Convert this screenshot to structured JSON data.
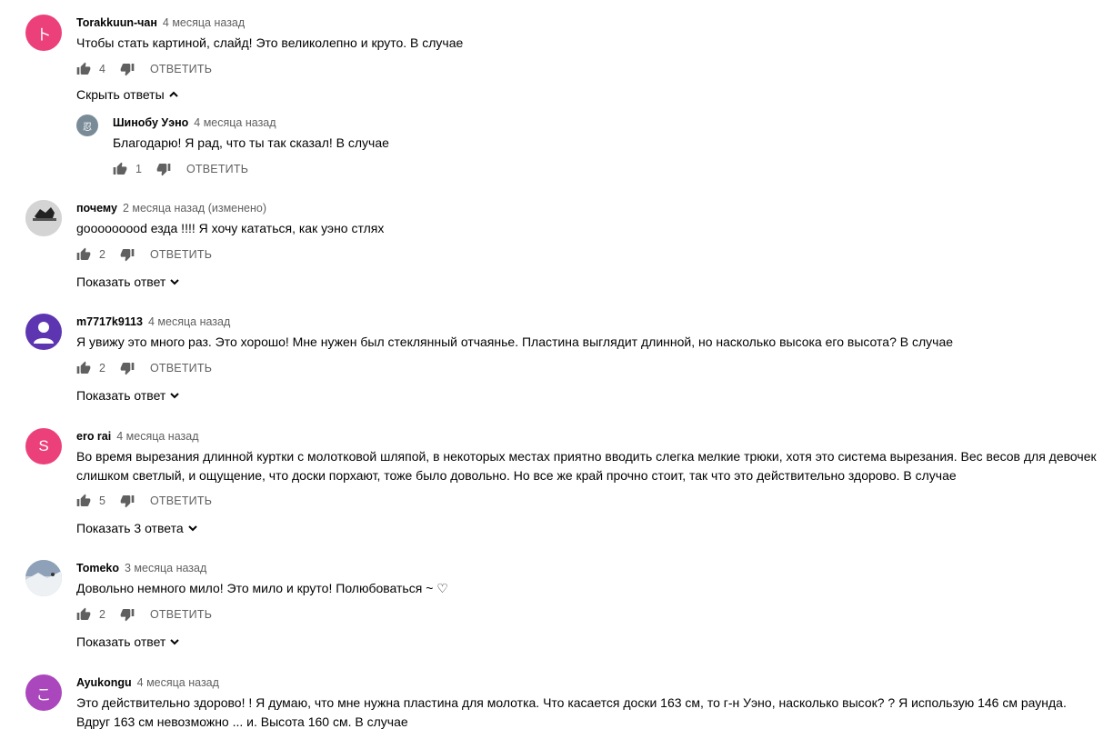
{
  "comments": [
    {
      "avatar_letter": "ト",
      "avatar_color": "#ec407a",
      "author": "Torakkuun-чан",
      "time": "4 месяца назад",
      "text": "Чтобы стать картиной, слайд! Это великолепно и круто. В случае",
      "likes": "4",
      "reply_label": "ОТВЕТИТЬ",
      "toggle": "Скрыть ответы",
      "replies": [
        {
          "avatar_letter": "忍",
          "avatar_color": "#7a8b98",
          "author": "Шинобу Уэно",
          "time": "4 месяца назад",
          "text": "Благодарю! Я рад, что ты так сказал! В случае",
          "likes": "1",
          "reply_label": "ОТВЕТИТЬ"
        }
      ]
    },
    {
      "avatar_letter": "",
      "avatar_color": "#d9d9d9",
      "author": "почему",
      "time": "2 месяца назад (изменено)",
      "text": "gooooooood езда !!!! Я хочу кататься, как уэно стлях",
      "likes": "2",
      "reply_label": "ОТВЕТИТЬ",
      "toggle": "Показать ответ"
    },
    {
      "avatar_letter": "",
      "avatar_color": "#5e35b1",
      "author": "m7717k9113",
      "time": "4 месяца назад",
      "text": "Я увижу это много раз. Это хорошо! Мне нужен был стеклянный отчаянье. Пластина выглядит длинной, но насколько высока его высота? В случае",
      "likes": "2",
      "reply_label": "ОТВЕТИТЬ",
      "toggle": "Показать ответ"
    },
    {
      "avatar_letter": "S",
      "avatar_color": "#ec407a",
      "author": "ero rai",
      "time": "4 месяца назад",
      "text": "Во время вырезания длинной куртки с молотковой шляпой, в некоторых местах приятно вводить слегка мелкие трюки, хотя это система вырезания. Вес весов для девочек слишком светлый, и ощущение, что доски порхают, тоже было довольно. Но все же край прочно стоит, так что это действительно здорово. В случае",
      "likes": "5",
      "reply_label": "ОТВЕТИТЬ",
      "toggle": "Показать 3 ответа"
    },
    {
      "avatar_letter": "",
      "avatar_color": "#b9c3cf",
      "author": "Tomeko",
      "time": "3 месяца назад",
      "text": "Довольно немного мило! Это мило и круто! Полюбоваться ~ ♡",
      "likes": "2",
      "reply_label": "ОТВЕТИТЬ",
      "toggle": "Показать ответ"
    },
    {
      "avatar_letter": "こ",
      "avatar_color": "#ab47bc",
      "author": "Ayukongu",
      "time": "4 месяца назад",
      "text": "Это действительно здорово! ! Я думаю, что мне нужна пластина для молотка. Что касается доски 163 см, то г-н Уэно, насколько высок? ? Я использую 146 см раунда. Вдруг 163 см невозможно ... и. Высота 160 см. В случае"
    }
  ]
}
